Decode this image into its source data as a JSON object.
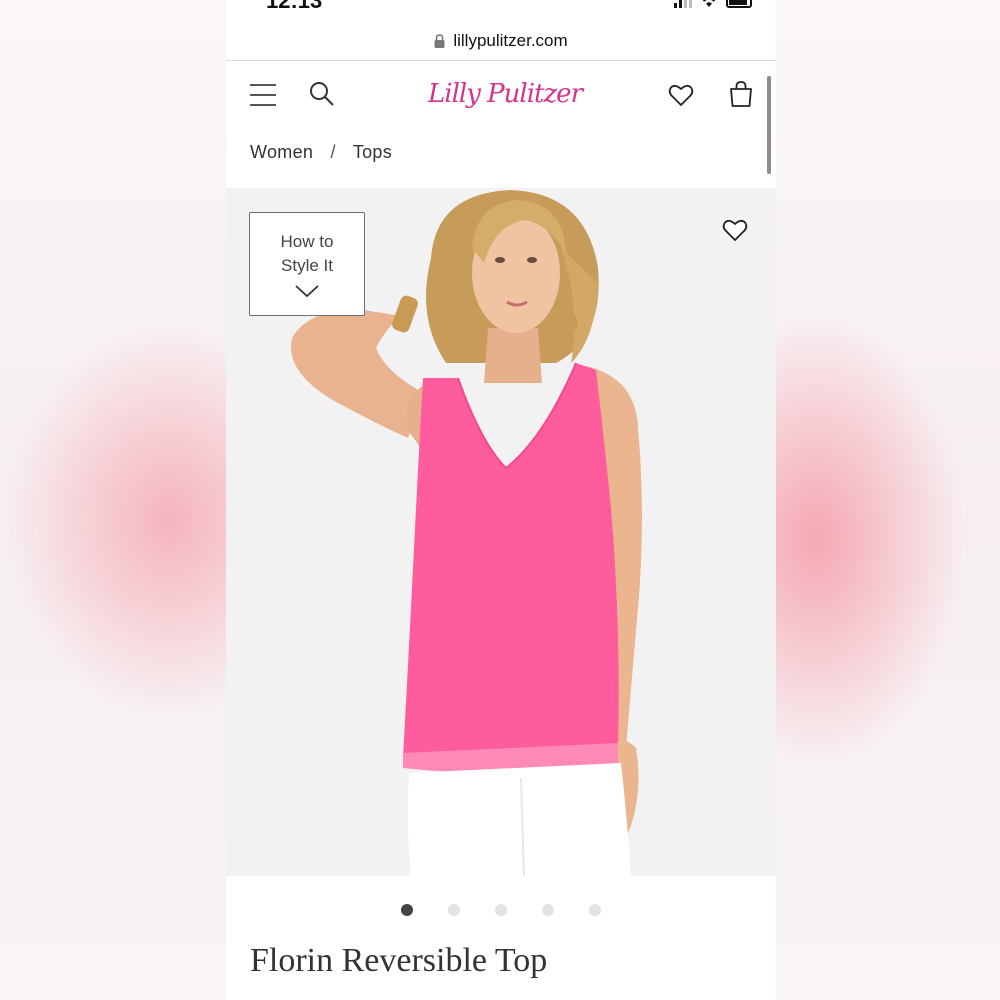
{
  "status_bar": {
    "time": "12:13"
  },
  "browser": {
    "url": "lillypulitzer.com"
  },
  "header": {
    "logo_text": "Lilly Pulitzer",
    "brand_color": "#d6338f",
    "icons": [
      "menu-icon",
      "search-icon",
      "heart-icon",
      "bag-icon"
    ]
  },
  "breadcrumb": [
    {
      "label": "Women"
    },
    {
      "label": "Tops"
    }
  ],
  "breadcrumb_separator": "/",
  "product": {
    "style_button_label": "How to Style It",
    "title": "Florin Reversible Top",
    "top_color": "#ff5c9d",
    "carousel": {
      "count": 5,
      "active_index": 1
    }
  }
}
